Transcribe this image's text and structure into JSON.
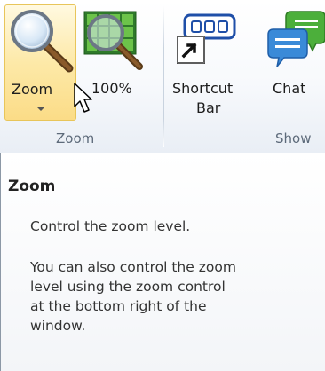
{
  "ribbon": {
    "buttons": {
      "zoom": {
        "label": "Zoom",
        "icon": "magnifier-icon"
      },
      "hundred": {
        "label": "100%",
        "icon": "magnifier-grid-icon"
      },
      "shortcut_bar": {
        "label_line1": "Shortcut",
        "label_line2": "Bar",
        "icon": "shortcut-bar-icon"
      },
      "chat": {
        "label": "Chat",
        "icon": "chat-bubble-icon"
      }
    },
    "groups": {
      "zoom": "Zoom",
      "show": "Show"
    }
  },
  "tooltip": {
    "title": "Zoom",
    "description": "Control the zoom level.",
    "detail_lines": [
      "You can also control the zoom",
      "level using the zoom control",
      "at the bottom right of the",
      "window."
    ]
  },
  "colors": {
    "hover_fill": "#fde9a8",
    "hover_border": "#e8c55a",
    "chat_green": "#4caf3b",
    "chat_blue": "#3a8ad8"
  }
}
